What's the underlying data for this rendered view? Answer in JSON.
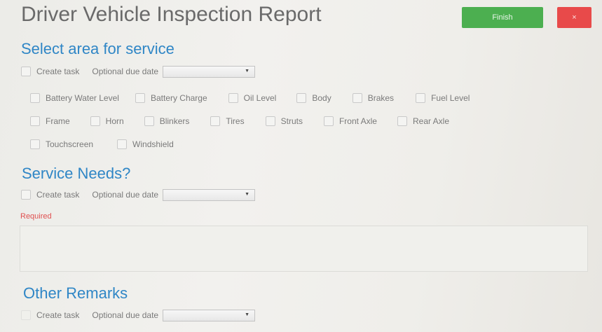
{
  "header": {
    "title": "Driver Vehicle Inspection Report",
    "finish_label": "Finish",
    "close_label": "×"
  },
  "sections": {
    "area": {
      "heading": "Select area for service",
      "create_task_label": "Create task",
      "due_date_label": "Optional due date",
      "due_date_value": "",
      "options": [
        "Battery Water Level",
        "Battery Charge",
        "Oil Level",
        "Body",
        "Brakes",
        "Fuel Level",
        "Frame",
        "Horn",
        "Blinkers",
        "Tires",
        "Struts",
        "Front Axle",
        "Rear Axle",
        "Touchscreen",
        "Windshield"
      ]
    },
    "needs": {
      "heading": "Service Needs?",
      "create_task_label": "Create task",
      "due_date_label": "Optional due date",
      "due_date_value": "",
      "required_label": "Required",
      "text_value": ""
    },
    "remarks": {
      "heading": "Other Remarks",
      "create_task_label": "Create task",
      "due_date_label": "Optional due date",
      "due_date_value": ""
    }
  },
  "colors": {
    "accent": "#2f86c6",
    "finish": "#4caf50",
    "close": "#e84a4a",
    "required": "#e05050"
  }
}
